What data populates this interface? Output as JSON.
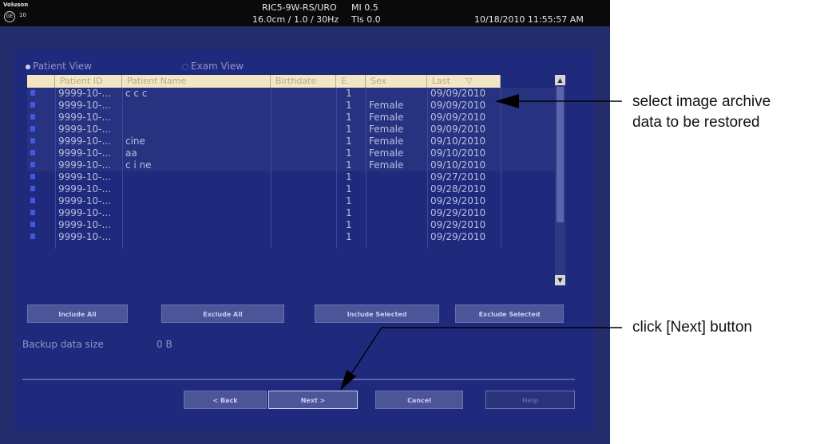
{
  "topbar": {
    "brand": "Voluson",
    "system_number": "10",
    "probe": "RIC5-9W-RS/URO",
    "mi": "MI 0.5",
    "depth": "16.0cm / 1.0 / 30Hz",
    "tis": "TIs 0.0",
    "datetime": "10/18/2010  11:55:57 AM"
  },
  "view_options": {
    "patient_view": "Patient View",
    "exam_view": "Exam View"
  },
  "table": {
    "headers": [
      "",
      "Patient ID",
      "Patient Name",
      "Birthdate",
      "E.",
      "Sex",
      "Last",
      ""
    ],
    "sort_indicator": "▽",
    "rows": [
      {
        "id": "9999-10-...",
        "name": "c c c",
        "birth": "",
        "e": "1",
        "sex": "",
        "last": "09/09/2010"
      },
      {
        "id": "9999-10-...",
        "name": "",
        "birth": "",
        "e": "1",
        "sex": "Female",
        "last": "09/09/2010"
      },
      {
        "id": "9999-10-...",
        "name": "",
        "birth": "",
        "e": "1",
        "sex": "Female",
        "last": "09/09/2010"
      },
      {
        "id": "9999-10-...",
        "name": "",
        "birth": "",
        "e": "1",
        "sex": "Female",
        "last": "09/09/2010"
      },
      {
        "id": "9999-10-...",
        "name": "cine",
        "birth": "",
        "e": "1",
        "sex": "Female",
        "last": "09/10/2010"
      },
      {
        "id": "9999-10-...",
        "name": "aa",
        "birth": "",
        "e": "1",
        "sex": "Female",
        "last": "09/10/2010"
      },
      {
        "id": "9999-10-...",
        "name": "c i ne",
        "birth": "",
        "e": "1",
        "sex": "Female",
        "last": "09/10/2010"
      },
      {
        "id": "9999-10-...",
        "name": "",
        "birth": "",
        "e": "1",
        "sex": "",
        "last": "09/27/2010"
      },
      {
        "id": "9999-10-...",
        "name": "",
        "birth": "",
        "e": "1",
        "sex": "",
        "last": "09/28/2010"
      },
      {
        "id": "9999-10-...",
        "name": "",
        "birth": "",
        "e": "1",
        "sex": "",
        "last": "09/29/2010"
      },
      {
        "id": "9999-10-...",
        "name": "",
        "birth": "",
        "e": "1",
        "sex": "",
        "last": "09/29/2010"
      },
      {
        "id": "9999-10-...",
        "name": "",
        "birth": "",
        "e": "1",
        "sex": "",
        "last": "09/29/2010"
      },
      {
        "id": "9999-10-...",
        "name": "",
        "birth": "",
        "e": "1",
        "sex": "",
        "last": "09/29/2010"
      }
    ]
  },
  "buttons": {
    "include_all": "Include All",
    "exclude_all": "Exclude All",
    "include_selected": "Include Selected",
    "exclude_selected": "Exclude Selected",
    "back": "< Back",
    "next": "Next >",
    "cancel": "Cancel",
    "help": "Help"
  },
  "backup": {
    "label": "Backup data size",
    "value": "0 B"
  },
  "callouts": {
    "select_line1": "select image archive",
    "select_line2": "data to be restored",
    "next": "click [Next] button"
  },
  "colors": {
    "screen_bg": "#242c6c",
    "panel_bg": "#1f2a7c",
    "header_bg": "#f3e6c4",
    "checkbox": "#4257e6",
    "button_bg": "#4b5598"
  }
}
